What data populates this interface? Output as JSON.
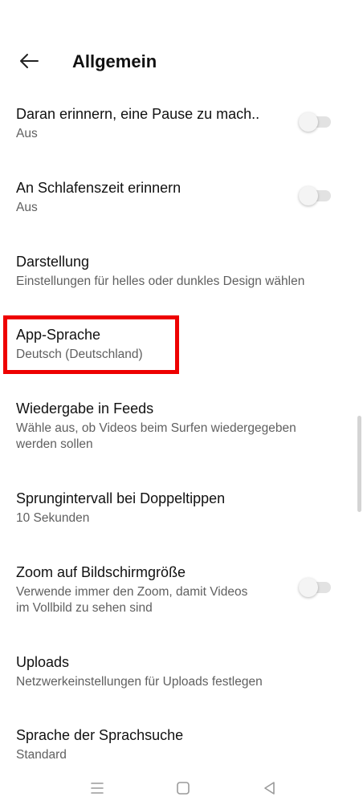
{
  "header": {
    "title": "Allgemein",
    "back_icon": "arrow-left-icon"
  },
  "settings": [
    {
      "title": "Daran erinnern, eine Pause zu mach..",
      "subtitle": "Aus",
      "toggle": true,
      "enabled": false
    },
    {
      "title": "An Schlafenszeit erinnern",
      "subtitle": "Aus",
      "toggle": true,
      "enabled": false
    },
    {
      "title": "Darstellung",
      "subtitle": "Einstellungen für helles oder dunkles Design wählen",
      "toggle": false
    },
    {
      "title": "App-Sprache",
      "subtitle": "Deutsch (Deutschland)",
      "toggle": false,
      "highlighted": true
    },
    {
      "title": "Wiedergabe in Feeds",
      "subtitle_lines": [
        "Wähle aus, ob Videos beim Surfen wiedergegeben",
        "werden sollen"
      ],
      "toggle": false
    },
    {
      "title": "Sprungintervall bei Doppeltippen",
      "subtitle": "10 Sekunden",
      "toggle": false
    },
    {
      "title": "Zoom auf Bildschirmgröße",
      "subtitle_lines": [
        "Verwende immer den Zoom, damit Videos",
        "im Vollbild zu sehen sind"
      ],
      "toggle": true,
      "enabled": false
    },
    {
      "title": "Uploads",
      "subtitle": "Netzwerkeinstellungen für Uploads festlegen",
      "toggle": false
    },
    {
      "title": "Sprache der Sprachsuche",
      "subtitle": "Standard",
      "toggle": false
    }
  ],
  "colors": {
    "highlight": "#ee0000",
    "text_primary": "#111111",
    "text_secondary": "#606060",
    "toggle_off_track": "#e2e2e2"
  },
  "system_nav": {
    "icons": [
      "menu-icon",
      "home-square-icon",
      "back-triangle-icon"
    ]
  }
}
